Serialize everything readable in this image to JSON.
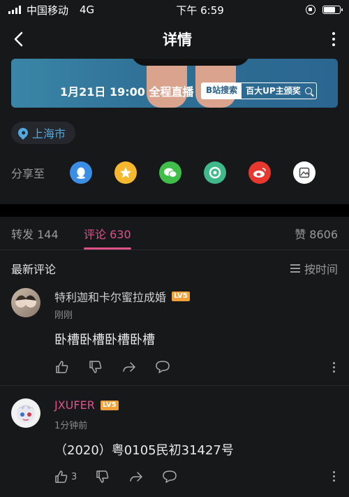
{
  "status": {
    "carrier": "中国移动",
    "network": "4G",
    "time": "下午 6:59",
    "battery_level": 0.8
  },
  "nav": {
    "title": "详情"
  },
  "banner": {
    "time_text": "1月21日 19:00 全程直播",
    "search_label": "B站搜索",
    "search_value": "百大UP主颁奖"
  },
  "location": {
    "text": "上海市"
  },
  "share": {
    "label": "分享至",
    "targets": [
      {
        "icon": "qq-icon",
        "color": "#3a8ee6"
      },
      {
        "icon": "qzone-icon",
        "color": "#f5b82e"
      },
      {
        "icon": "wechat-icon",
        "color": "#3fbf4a"
      },
      {
        "icon": "moments-icon",
        "color": "#3fb88a"
      },
      {
        "icon": "weibo-icon",
        "color": "#e6382f"
      },
      {
        "icon": "image-icon",
        "color": "#ffffff"
      }
    ]
  },
  "tabs": {
    "repost": "转发 144",
    "comments": "评论 630",
    "likes": "赞 8606"
  },
  "comments_section": {
    "title": "最新评论",
    "sort": "按时间"
  },
  "comments": [
    {
      "user": "特利迦和卡尔蜜拉成婚",
      "level": "LV5",
      "time": "刚刚",
      "text": "卧槽卧槽卧槽卧槽",
      "like_count": "",
      "name_color": "#d0d0d0"
    },
    {
      "user": "JXUFER",
      "level": "LV5",
      "time": "1分钟前",
      "text": "（2020）粤0105民初31427号",
      "like_count": "3",
      "name_color": "#e05287"
    }
  ],
  "colors": {
    "accent": "#e05287",
    "background": "#17181a",
    "location": "#52a8e0"
  }
}
